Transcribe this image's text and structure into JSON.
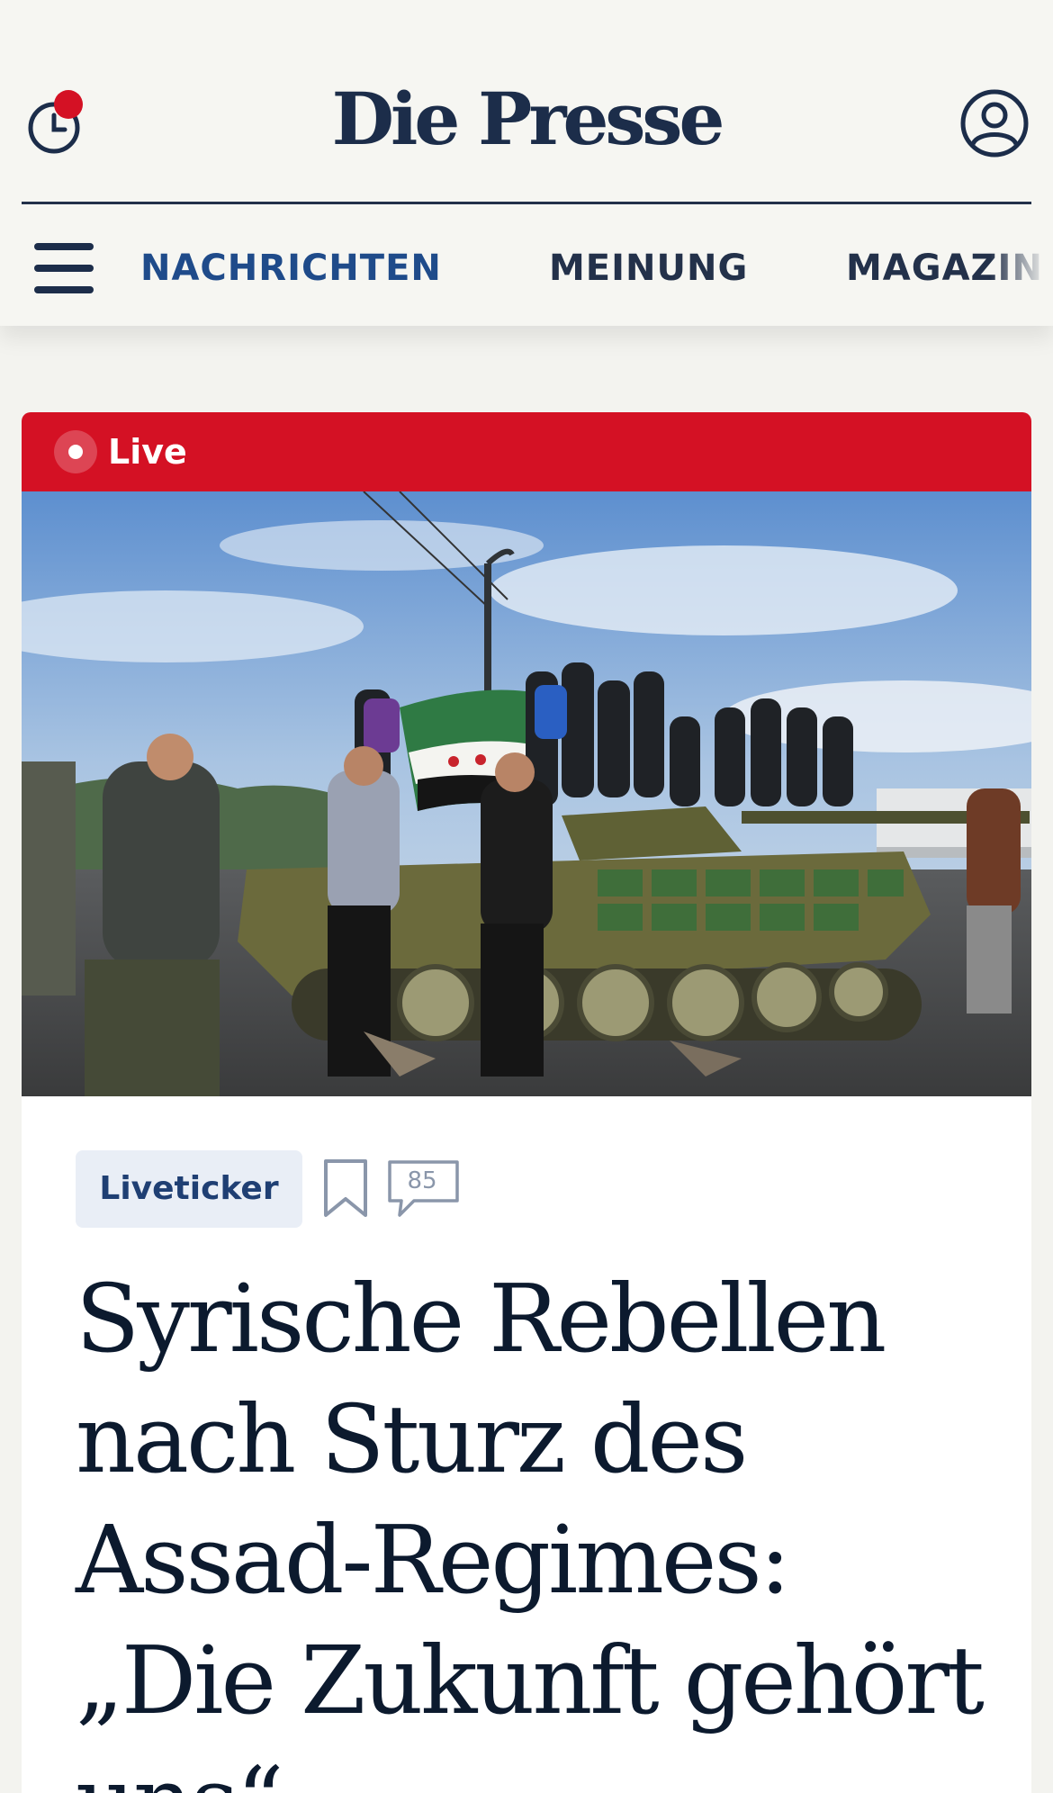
{
  "header": {
    "logo_text": "Die Presse",
    "history_icon": "clock-icon",
    "account_icon": "user-icon",
    "menu_icon": "hamburger-menu-icon"
  },
  "nav": {
    "items": [
      {
        "label": "NACHRICHTEN"
      },
      {
        "label": "MEINUNG"
      },
      {
        "label": "MAGAZIN"
      }
    ]
  },
  "article": {
    "live_label": "Live",
    "category_tag": "Liveticker",
    "comment_count": "85",
    "headline": "Syrische Rebellen nach Sturz des Assad-Regimes: „Die Zukunft gehört uns“",
    "image_icon": "photo-rebels-on-tank"
  },
  "colors": {
    "brand_navy": "#1c2d4a",
    "live_red": "#d41124",
    "nav_active": "#1f4b8a",
    "background": "#f3f3ef"
  }
}
